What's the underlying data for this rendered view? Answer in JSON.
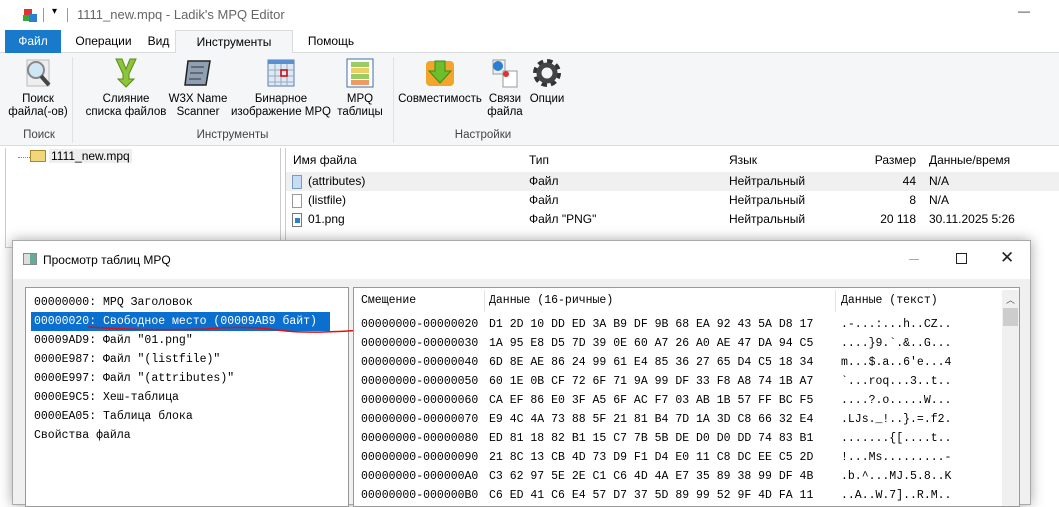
{
  "window": {
    "title": "1111_new.mpq - Ladik's MPQ Editor",
    "minimize": "—"
  },
  "tabs": [
    "Файл",
    "Операции",
    "Вид",
    "Инструменты",
    "Помощь"
  ],
  "ribbon": {
    "buttons": [
      {
        "line1": "Поиск",
        "line2": "файла(-ов)",
        "icon": "search-icon"
      },
      {
        "line1": "Слияние",
        "line2": "списка файлов",
        "icon": "merge-icon"
      },
      {
        "line1": "W3X Name",
        "line2": "Scanner",
        "icon": "scroll-icon"
      },
      {
        "line1": "Бинарное",
        "line2": "изображение MPQ",
        "icon": "grid-icon"
      },
      {
        "line1": "MPQ",
        "line2": "таблицы",
        "icon": "table-icon"
      },
      {
        "line1": "Совместимость",
        "line2": "",
        "icon": "download-folder-icon"
      },
      {
        "line1": "Связи",
        "line2": "файла",
        "icon": "file-assoc-icon"
      },
      {
        "line1": "Опции",
        "line2": "",
        "icon": "gear-icon"
      }
    ],
    "groups": [
      "Поиск",
      "Инструменты",
      "Настройки"
    ]
  },
  "tree": {
    "root": "1111_new.mpq"
  },
  "list": {
    "headers": [
      "Имя файла",
      "Тип",
      "Язык",
      "Размер",
      "Данные/время"
    ],
    "rows": [
      {
        "name": "(attributes)",
        "type": "Файл",
        "lang": "Нейтральный",
        "size": "44",
        "date": "N/A"
      },
      {
        "name": "(listfile)",
        "type": "Файл",
        "lang": "Нейтральный",
        "size": "8",
        "date": "N/A"
      },
      {
        "name": "01.png",
        "type": "Файл \"PNG\"",
        "lang": "Нейтральный",
        "size": "20 118",
        "date": "30.11.2025 5:26"
      }
    ]
  },
  "dialog": {
    "title": "Просмотр таблиц MPQ",
    "items": [
      "00000000: MPQ Заголовок",
      "00000020: Свободное место (00009AB9 байт)",
      "00009AD9: Файл \"01.png\"",
      "0000E987: Файл \"(listfile)\"",
      "0000E997: Файл \"(attributes)\"",
      "0000E9C5: Хеш-таблица",
      "0000EA05: Таблица блока",
      "Свойства файла"
    ],
    "selected": 1,
    "hex_headers": [
      "Смещение",
      "Данные (16-ричные)",
      "Данные (текст)"
    ],
    "hex_rows": [
      {
        "off": "00000000-00000020",
        "hex": "D1 2D 10 DD ED 3A B9 DF 9B 68 EA 92 43 5A D8 17",
        "text": ".-...:...h..CZ.."
      },
      {
        "off": "00000000-00000030",
        "hex": "1A 95 E8 D5 7D 39 0E 60 A7 26 A0 AE 47 DA 94 C5",
        "text": "....}9.`.&..G..."
      },
      {
        "off": "00000000-00000040",
        "hex": "6D 8E AE 86 24 99 61 E4 85 36 27 65 D4 C5 18 34",
        "text": "m...$.a..6'e...4"
      },
      {
        "off": "00000000-00000050",
        "hex": "60 1E 0B CF 72 6F 71 9A 99 DF 33 F8 A8 74 1B A7",
        "text": "`...roq...3..t.."
      },
      {
        "off": "00000000-00000060",
        "hex": "CA EF 86 E0 3F A5 6F AC F7 03 AB 1B 57 FF BC F5",
        "text": "....?.o.....W..."
      },
      {
        "off": "00000000-00000070",
        "hex": "E9 4C 4A 73 88 5F 21 81 B4 7D 1A 3D C8 66 32 E4",
        "text": ".LJs._!..}.=.f2."
      },
      {
        "off": "00000000-00000080",
        "hex": "ED 81 18 82 B1 15 C7 7B 5B DE D0 D0 DD 74 83 B1",
        "text": ".......{[....t.."
      },
      {
        "off": "00000000-00000090",
        "hex": "21 8C 13 CB 4D 73 D9 F1 D4 E0 11 C8 DC EE C5 2D",
        "text": "!...Ms.........-"
      },
      {
        "off": "00000000-000000A0",
        "hex": "C3 62 97 5E 2E C1 C6 4D 4A E7 35 89 38 99 DF 4B",
        "text": ".b.^...MJ.5.8..K"
      },
      {
        "off": "00000000-000000B0",
        "hex": "C6 ED 41 C6 E4 57 D7 37 5D 89 99 52 9F 4D FA 11",
        "text": "..A..W.7]..R.M.."
      }
    ]
  },
  "colors": {
    "accent": "#1979ca",
    "selection": "#0a6fcf"
  }
}
